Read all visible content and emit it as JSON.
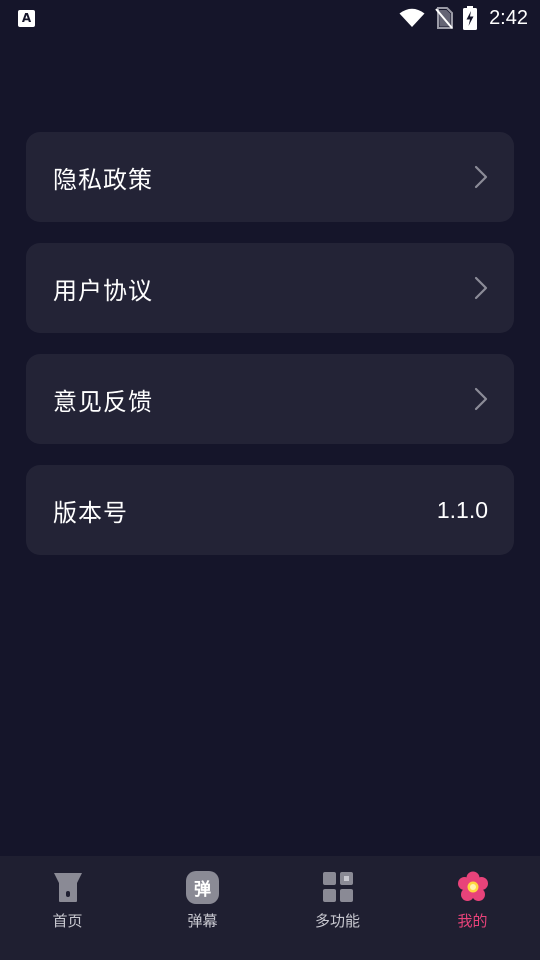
{
  "status_bar": {
    "time": "2:42",
    "notification_glyph": "A",
    "icons": [
      "wifi-icon",
      "no-sim-icon",
      "battery-charging-icon"
    ]
  },
  "settings": {
    "items": [
      {
        "label": "隐私政策",
        "icon": "chevron-right-icon"
      },
      {
        "label": "用户协议",
        "icon": "chevron-right-icon"
      },
      {
        "label": "意见反馈",
        "icon": "chevron-right-icon"
      }
    ],
    "version": {
      "label": "版本号",
      "value": "1.1.0"
    }
  },
  "bottom_nav": {
    "items": [
      {
        "label": "首页",
        "icon": "funnel-icon"
      },
      {
        "label": "弹幕",
        "icon": "danmaku-badge-icon",
        "badge_text": "弹"
      },
      {
        "label": "多功能",
        "icon": "grid-icon"
      },
      {
        "label": "我的",
        "icon": "flower-icon",
        "active": true
      }
    ],
    "active_color": "#e8437a"
  },
  "colors": {
    "background": "#15152a",
    "card": "#232336",
    "nav_background": "#1f1f31",
    "accent": "#e8437a"
  }
}
